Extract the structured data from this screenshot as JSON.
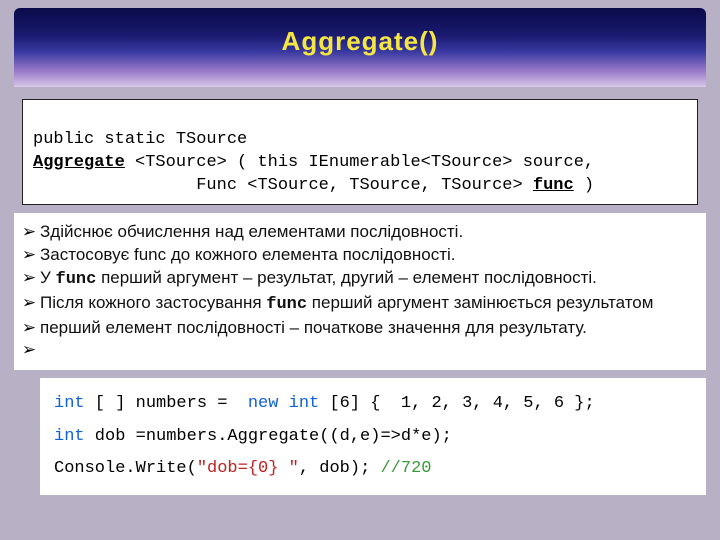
{
  "title": "Aggregate()",
  "signature": {
    "line1_pre": "public static TSource",
    "method": "Aggregate",
    "line2_after_method": " <TSource> ( this IEnumerable<TSource> source,",
    "line3_pre": "                Func <TSource, TSource, TSource> ",
    "param": "func",
    "line3_post": " )"
  },
  "bullets": [
    "Здійснює обчислення над елементами послідовності.",
    "Застосовує func до кожного елемента послідовності.",
    "У <mono>func</mono> перший аргумент – результат, другий – елемент послідовності.",
    "Після кожного застосування <mono>func</mono> перший аргумент замінюється результатом",
    "перший елемент послідовності – початкове значення для результату.",
    ""
  ],
  "sample": {
    "line1": "<kw>int</kw> [ ] numbers =  <kw>new int</kw> [6] {  1, 2, 3, 4, 5, 6 };",
    "line2": "<kw>int</kw> dob =numbers.Aggregate((d,e)=>d*e);",
    "line3": "Console.Write(<str>\"dob={0} \"</str>, dob); <com>//720</com>"
  }
}
